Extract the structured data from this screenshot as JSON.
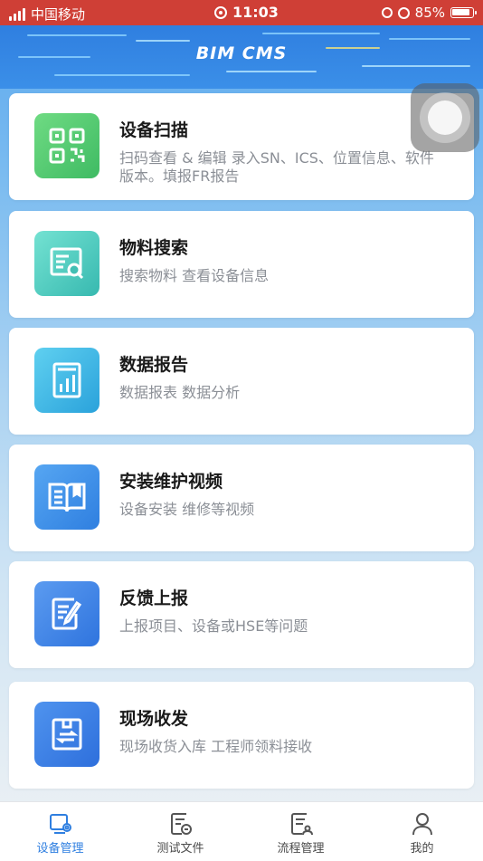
{
  "status_bar": {
    "carrier": "中国移动",
    "time": "11:03",
    "battery": "85%"
  },
  "banner": {
    "logo_text": "BIM CMS"
  },
  "cards": [
    {
      "title": "设备扫描",
      "description": "扫码查看 & 编辑 录入SN、ICS、位置信息、软件版本。填报FR报告",
      "icon": "qr-code-icon",
      "color": "#4cc46d"
    },
    {
      "title": "物料搜索",
      "description": "搜索物料 查看设备信息",
      "icon": "material-search-icon",
      "color": "#45c4b8"
    },
    {
      "title": "数据报告",
      "description": "数据报表 数据分析",
      "icon": "data-report-icon",
      "color": "#3ab0e4"
    },
    {
      "title": "安装维护视频",
      "description": "设备安装 维修等视频",
      "icon": "book-icon",
      "color": "#3d8fe8"
    },
    {
      "title": "反馈上报",
      "description": "上报项目、设备或HSE等问题",
      "icon": "edit-note-icon",
      "color": "#3a82e6"
    },
    {
      "title": "现场收发",
      "description": "现场收货入库 工程师领料接收",
      "icon": "transfer-box-icon",
      "color": "#3679e2"
    }
  ],
  "tabs": [
    {
      "label": "设备管理",
      "icon": "device-manage-icon",
      "active": true
    },
    {
      "label": "测试文件",
      "icon": "test-file-icon",
      "active": false
    },
    {
      "label": "流程管理",
      "icon": "process-manage-icon",
      "active": false
    },
    {
      "label": "我的",
      "icon": "profile-icon",
      "active": false
    }
  ],
  "colors": {
    "status_bar": "#cf3f36",
    "accent": "#2f7fe0",
    "banner": "#3488e6"
  }
}
